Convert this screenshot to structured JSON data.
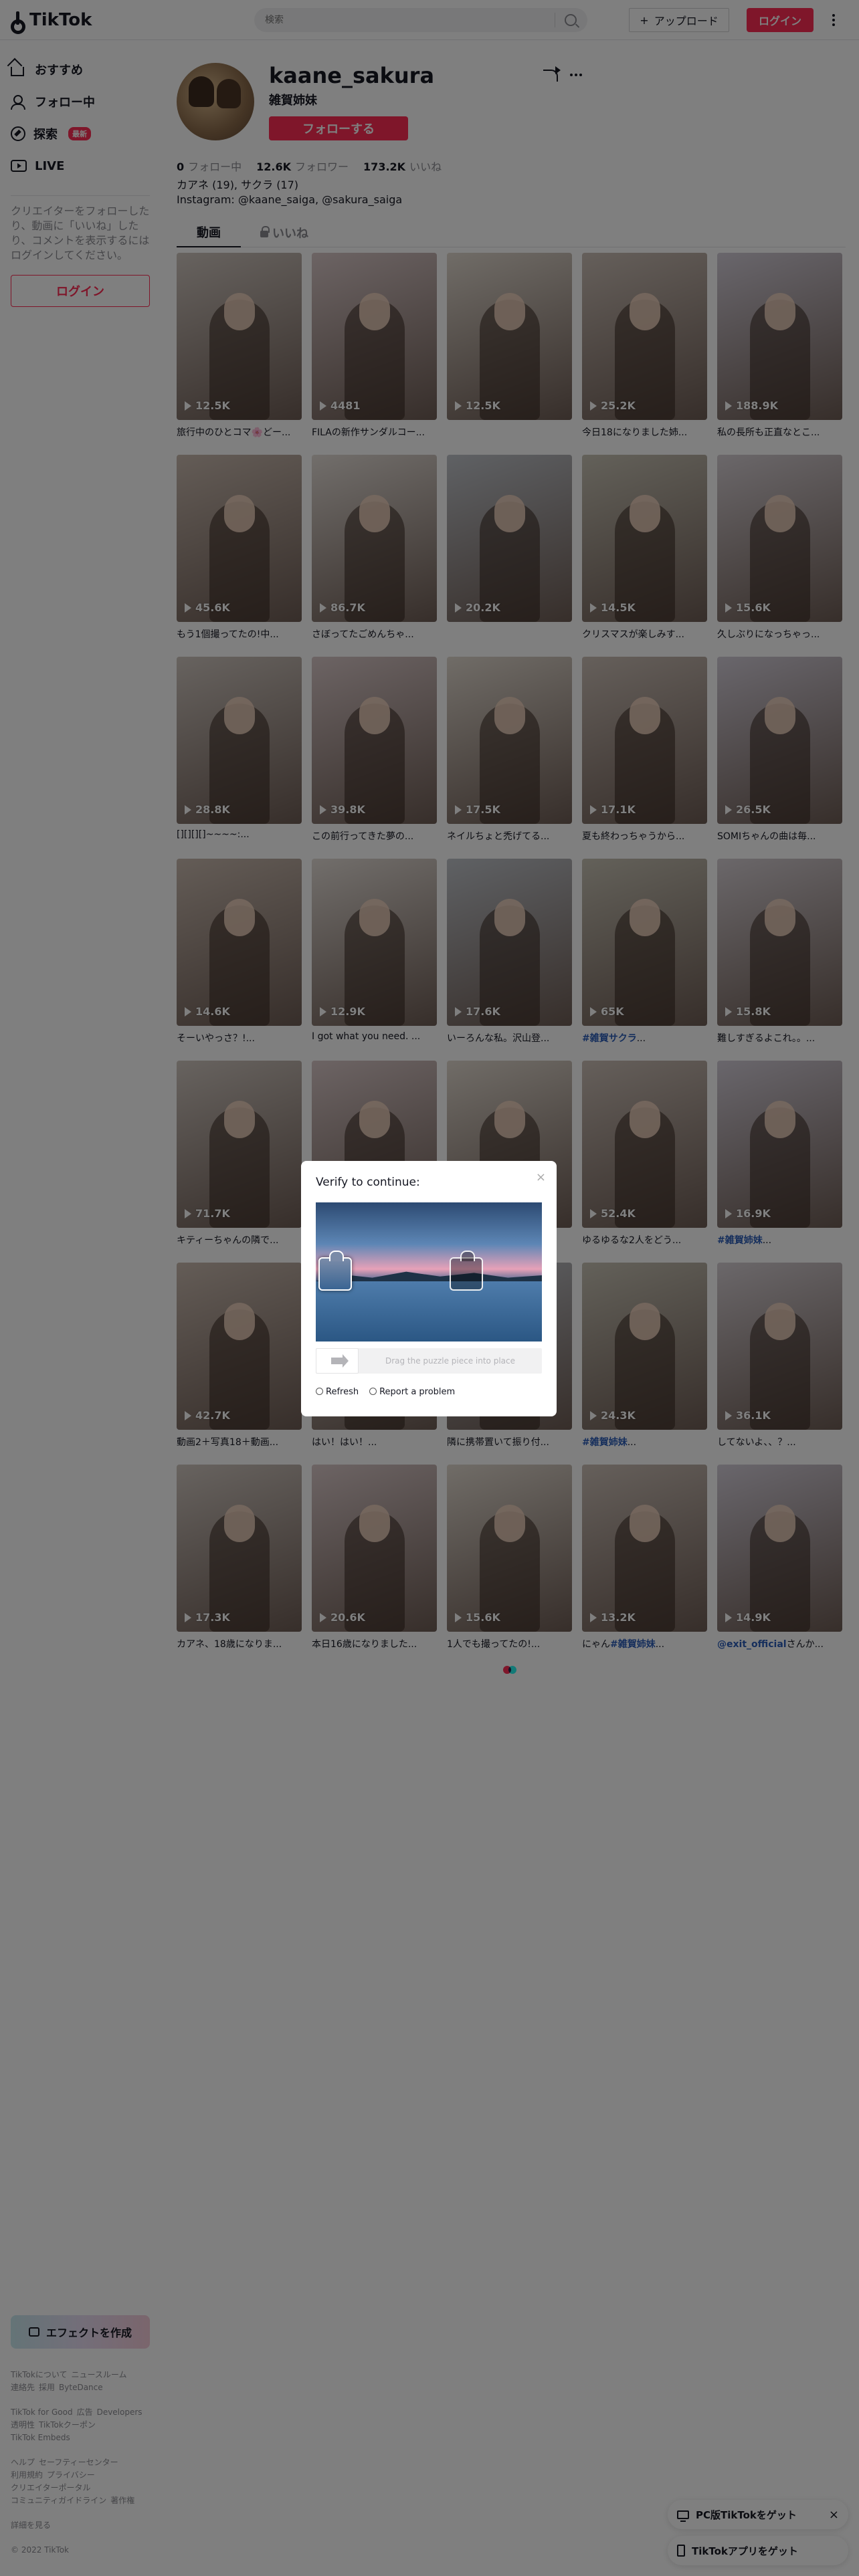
{
  "header": {
    "logo_text": "TikTok",
    "search_placeholder": "検索",
    "upload_label": "アップロード",
    "login_label": "ログイン"
  },
  "sidebar": {
    "nav": [
      {
        "label": "おすすめ",
        "icon": "home-icon"
      },
      {
        "label": "フォロー中",
        "icon": "following-icon"
      },
      {
        "label": "探索",
        "icon": "compass-icon",
        "badge": "最新"
      },
      {
        "label": "LIVE",
        "icon": "live-icon"
      }
    ],
    "prompt": "クリエイターをフォローしたり、動画に「いいね」したり、コメントを表示するにはログインしてください。",
    "login_label": "ログイン",
    "effect_label": "エフェクトを作成",
    "footer": [
      [
        "TikTokについて",
        "ニュースルーム",
        "連絡先",
        "採用",
        "ByteDance"
      ],
      [
        "TikTok for Good",
        "広告",
        "Developers",
        "透明性",
        "TikTokクーポン",
        "TikTok Embeds"
      ],
      [
        "ヘルプ",
        "セーフティーセンター",
        "利用規約",
        "プライバシー",
        "クリエイターポータル",
        "コミュニティガイドライン",
        "著作権"
      ],
      [
        "詳細を見る"
      ],
      [
        "© 2022 TikTok"
      ]
    ]
  },
  "profile": {
    "username": "kaane_sakura",
    "nickname": "雑賀姉妹",
    "follow_label": "フォローする",
    "stats": [
      {
        "value": "0",
        "label": "フォロー中"
      },
      {
        "value": "12.6K",
        "label": "フォロワー"
      },
      {
        "value": "173.2K",
        "label": "いいね"
      }
    ],
    "bio_line1": "カアネ (19), サクラ (17)",
    "bio_line2": "Instagram: @kaane_saiga, @sakura_saiga",
    "tabs": [
      "動画",
      "いいね"
    ]
  },
  "videos": [
    {
      "views": "12.5K",
      "caption": "旅行中のひとコマ🌸どー..."
    },
    {
      "views": "4481",
      "caption": "FILAの新作サンダルコー..."
    },
    {
      "views": "12.5K",
      "caption": ""
    },
    {
      "views": "25.2K",
      "caption": "今日18になりました姉..."
    },
    {
      "views": "188.9K",
      "caption": "私の長所も正直なとこ..."
    },
    {
      "views": "45.6K",
      "caption": "もう1個撮ってたの!中..."
    },
    {
      "views": "86.7K",
      "caption": "さぼってたごめんちゃ..."
    },
    {
      "views": "20.2K",
      "caption": ""
    },
    {
      "views": "14.5K",
      "caption": "クリスマスが楽しみす..."
    },
    {
      "views": "15.6K",
      "caption": "久しぶりになっちゃっ..."
    },
    {
      "views": "28.8K",
      "caption": "[][][][]~~~~:..."
    },
    {
      "views": "39.8K",
      "caption": "この前行ってきた夢の..."
    },
    {
      "views": "17.5K",
      "caption": "ネイルちょと禿げてる..."
    },
    {
      "views": "17.1K",
      "caption": "夏も終わっちゃうから..."
    },
    {
      "views": "26.5K",
      "caption": "SOMIちゃんの曲は毎..."
    },
    {
      "views": "14.6K",
      "caption": "そーいやっさ？!..."
    },
    {
      "views": "12.9K",
      "caption": "I got what you need. ..."
    },
    {
      "views": "17.6K",
      "caption": "いーろんな私。沢山登..."
    },
    {
      "views": "65K",
      "caption": "",
      "tag": "#雑賀サクラ",
      "tag_after": "..."
    },
    {
      "views": "15.8K",
      "caption": "難しすぎるよこれ。。..."
    },
    {
      "views": "71.7K",
      "caption": "キティーちゃんの隣で..."
    },
    {
      "views": "",
      "caption": ""
    },
    {
      "views": "",
      "caption": ""
    },
    {
      "views": "52.4K",
      "caption": "ゆるゆるな2人をどう..."
    },
    {
      "views": "16.9K",
      "caption": "",
      "tag": "#雑賀姉妹",
      "tag_after": "..."
    },
    {
      "views": "42.7K",
      "caption": "動画2＋写真18＋動画..."
    },
    {
      "views": "",
      "caption": "はい！はい！..."
    },
    {
      "views": "",
      "caption": "隣に携帯置いて振り付..."
    },
    {
      "views": "24.3K",
      "caption": "",
      "tag": "#雑賀姉妹",
      "tag_after": "..."
    },
    {
      "views": "36.1K",
      "caption": "してないよ、、？..."
    },
    {
      "views": "17.3K",
      "caption": "カアネ、18歳になりま..."
    },
    {
      "views": "20.6K",
      "caption": "本日16歳になりました..."
    },
    {
      "views": "15.6K",
      "caption": "1人でも撮ってたの!..."
    },
    {
      "views": "13.2K",
      "caption": "にゃん",
      "tag": "#雑賀姉妹",
      "tag_after": "..."
    },
    {
      "views": "14.9K",
      "caption": "",
      "tag": "@exit_official",
      "tag_after": "さんか..."
    }
  ],
  "captcha": {
    "title": "Verify to continue:",
    "slider_hint": "Drag the puzzle piece into place",
    "refresh_label": "Refresh",
    "report_label": "Report a problem",
    "close": "×"
  },
  "app_prompts": {
    "pc_label": "PC版TikTokをゲット",
    "app_label": "TikTokアプリをゲット",
    "close": "×"
  }
}
